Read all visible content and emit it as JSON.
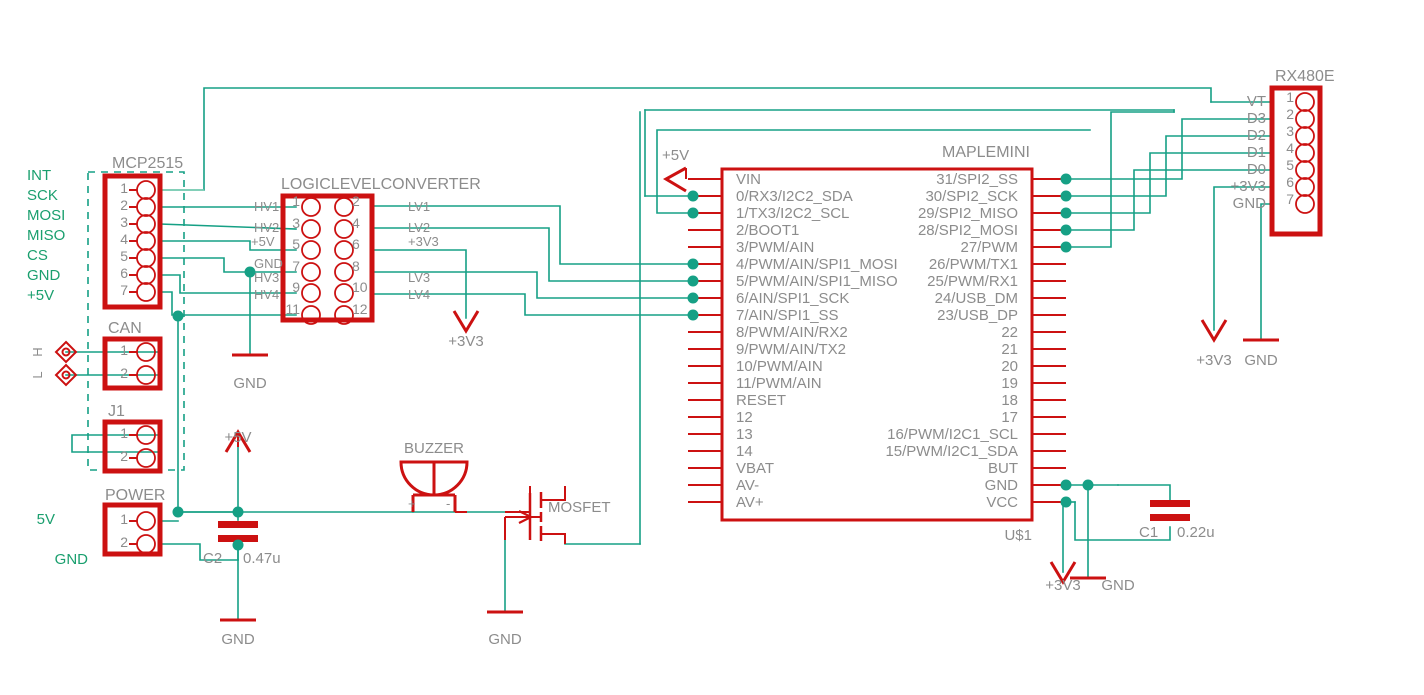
{
  "meta": {
    "title": "Schematic capture canvas",
    "background": "#ffffff",
    "wire_color": "#16a085",
    "part_color": "#cc1111",
    "label_color": "#8c8c8c",
    "net_label_color": "#1a9f6e"
  },
  "components": {
    "mcp2515": {
      "name": "MCP2515",
      "pins": [
        "1",
        "2",
        "3",
        "4",
        "5",
        "6",
        "7"
      ],
      "net_labels": [
        "INT",
        "SCK",
        "MOSI",
        "MISO",
        "CS",
        "GND",
        "+5V"
      ]
    },
    "can": {
      "name": "CAN",
      "pins": [
        "1",
        "2"
      ],
      "net_labels": [
        "H",
        "L"
      ]
    },
    "j1": {
      "name": "J1",
      "pins": [
        "1",
        "2"
      ]
    },
    "power": {
      "name": "POWER",
      "pins": [
        "1",
        "2"
      ],
      "net_labels": [
        "5V",
        "GND"
      ]
    },
    "logiclevelconverter": {
      "name": "LOGICLEVELCONVERTER",
      "left_pins": [
        "1",
        "3",
        "5",
        "7",
        "9",
        "11"
      ],
      "right_pins": [
        "2",
        "4",
        "6",
        "8",
        "10",
        "12"
      ],
      "left_net_labels": [
        "HV1",
        "HV2",
        "+5V",
        "GND",
        "HV3",
        "HV4"
      ],
      "right_net_labels": [
        "LV1",
        "LV2",
        "+3V3",
        "",
        "LV3",
        "LV4"
      ]
    },
    "maplemini": {
      "name": "MAPLEMINI",
      "designator": "U$1",
      "left_pins": [
        "VIN",
        "0/RX3/I2C2_SDA",
        "1/TX3/I2C2_SCL",
        "2/BOOT1",
        "3/PWM/AIN",
        "4/PWM/AIN/SPI1_MOSI",
        "5/PWM/AIN/SPI1_MISO",
        "6/AIN/SPI1_SCK",
        "7/AIN/SPI1_SS",
        "8/PWM/AIN/RX2",
        "9/PWM/AIN/TX2",
        "10/PWM/AIN",
        "11/PWM/AIN",
        "RESET",
        "12",
        "13",
        "14",
        "VBAT",
        "AV-",
        "AV+"
      ],
      "right_pins": [
        "31/SPI2_SS",
        "30/SPI2_SCK",
        "29/SPI2_MISO",
        "28/SPI2_MOSI",
        "27/PWM",
        "26/PWM/TX1",
        "25/PWM/RX1",
        "24/USB_DM",
        "23/USB_DP",
        "22",
        "21",
        "20",
        "19",
        "18",
        "17",
        "16/PWM/I2C1_SCL",
        "15/PWM/I2C1_SDA",
        "BUT",
        "GND",
        "VCC"
      ]
    },
    "rx480e": {
      "name": "RX480E",
      "pins": [
        "1",
        "2",
        "3",
        "4",
        "5",
        "6",
        "7"
      ],
      "net_labels": [
        "VT",
        "D3",
        "D2",
        "D1",
        "D0",
        "+3V3",
        "GND"
      ]
    },
    "buzzer": {
      "name": "BUZZER",
      "plus": "+",
      "minus": "-"
    },
    "mosfet": {
      "name": "MOSFET"
    },
    "c1": {
      "name": "C1",
      "value": "0.22u"
    },
    "c2": {
      "name": "C2",
      "value": "0.47u"
    }
  },
  "power_symbols": {
    "plus5v_power": "+5V",
    "plus5v_vin": "+5V",
    "gnd_llc": "GND",
    "gnd_c2": "GND",
    "gnd_mosfet": "GND",
    "plus3v3_llc": "+3V3",
    "plus3v3_rx": "+3V3",
    "gnd_rx": "GND",
    "plus3v3_c1": "+3V3",
    "gnd_c1": "GND"
  }
}
